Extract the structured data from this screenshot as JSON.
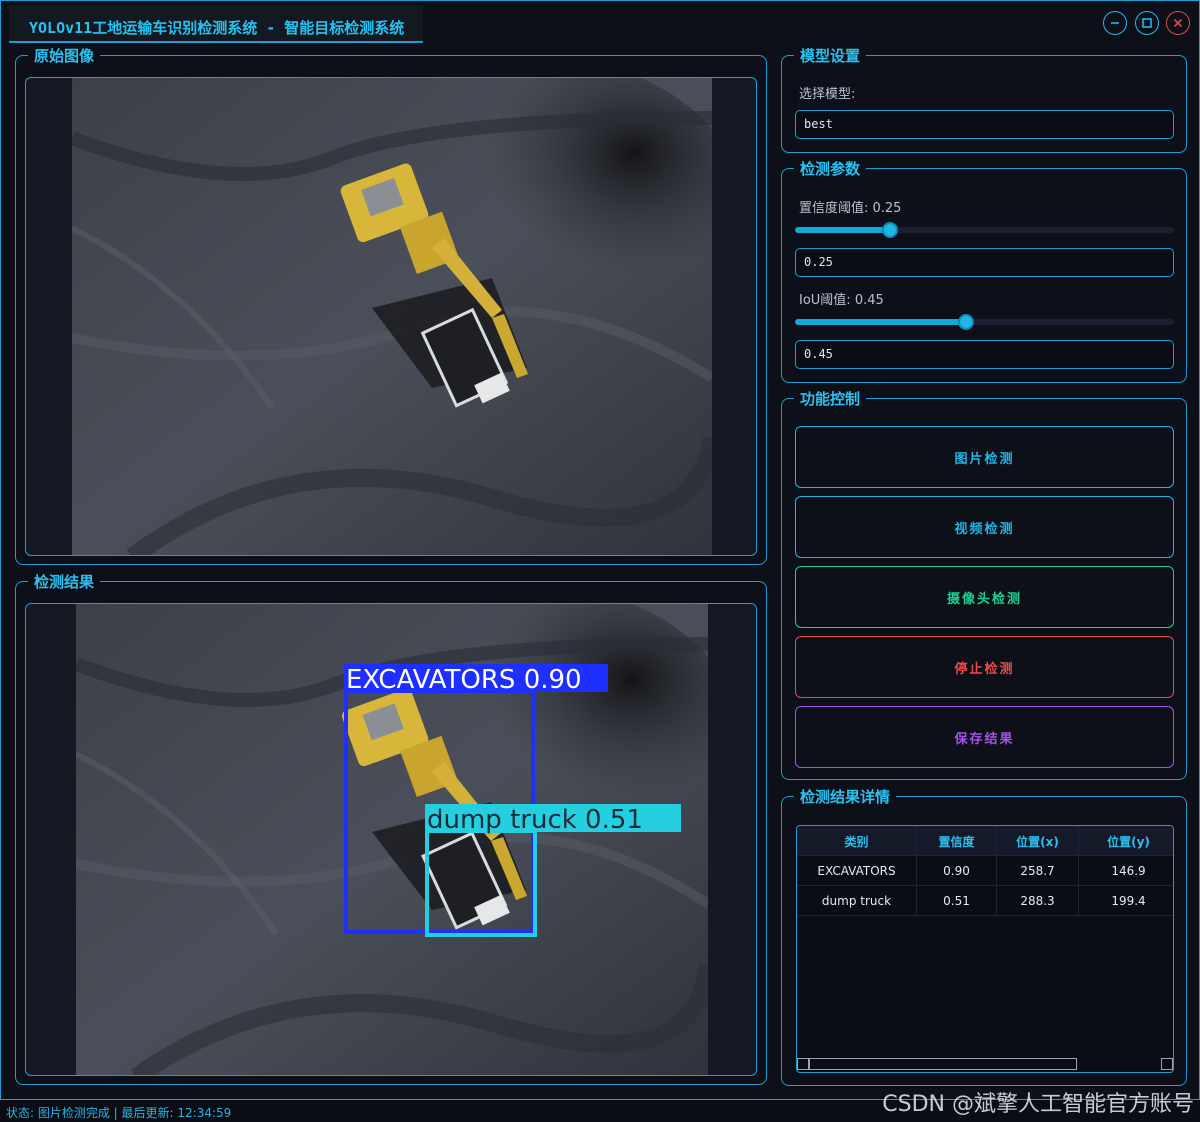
{
  "window": {
    "title": "YOLOv11工地运输车识别检测系统 - 智能目标检测系统",
    "minimize_icon": "minimize-icon",
    "maximize_icon": "maximize-icon",
    "close_icon": "close-icon",
    "accent_color": "#1d9fd6",
    "close_color": "#e0484b"
  },
  "original_panel": {
    "title": "原始图像"
  },
  "result_panel": {
    "title": "检测结果",
    "detections": [
      {
        "label": "EXCAVATORS 0.90",
        "color": "#1f2fff"
      },
      {
        "label": "dump truck 0.51",
        "color": "#25cfe0"
      }
    ]
  },
  "model_settings": {
    "title": "模型设置",
    "select_label": "选择模型:",
    "model_value": "best"
  },
  "detect_params": {
    "title": "检测参数",
    "confidence_label": "置信度阈值: 0.25",
    "confidence_value": "0.25",
    "confidence_level": 0.25,
    "iou_label": "IoU阈值: 0.45",
    "iou_value": "0.45",
    "iou_level": 0.45
  },
  "function_control": {
    "title": "功能控制",
    "buttons": [
      {
        "label": "图片检测",
        "color": "#1fb6e6"
      },
      {
        "label": "视频检测",
        "color": "#1fb6e6"
      },
      {
        "label": "摄像头检测",
        "color": "#1fcf8f"
      },
      {
        "label": "停止检测",
        "color": "#e94b4b"
      },
      {
        "label": "保存结果",
        "color": "#a552e6"
      }
    ]
  },
  "results_detail": {
    "title": "检测结果详情",
    "columns": [
      "类别",
      "置信度",
      "位置(x)",
      "位置(y)"
    ],
    "rows": [
      [
        "EXCAVATORS",
        "0.90",
        "258.7",
        "146.9"
      ],
      [
        "dump truck",
        "0.51",
        "288.3",
        "199.4"
      ]
    ]
  },
  "status": {
    "text": "状态: 图片检测完成 | 最后更新: 12:34:59"
  },
  "watermark": "CSDN @斌擎人工智能官方账号"
}
